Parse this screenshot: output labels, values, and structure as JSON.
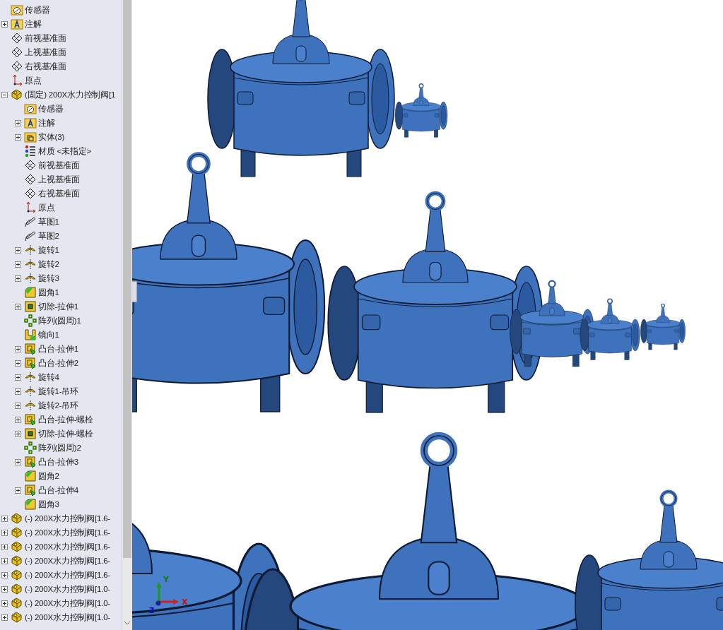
{
  "tree": {
    "items": [
      {
        "label": "传感器",
        "kind": "sensor-folder"
      },
      {
        "label": "注解",
        "kind": "annotation-folder",
        "expanded": false
      },
      {
        "label": "前视基准面",
        "kind": "plane"
      },
      {
        "label": "上视基准面",
        "kind": "plane"
      },
      {
        "label": "右视基准面",
        "kind": "plane"
      },
      {
        "label": "原点",
        "kind": "origin"
      },
      {
        "label": "(固定) 200X水力控制阀[1",
        "kind": "part",
        "expanded": true,
        "children": [
          {
            "label": "传感器",
            "kind": "sensor-folder"
          },
          {
            "label": "注解",
            "kind": "annotation-folder",
            "expanded": false
          },
          {
            "label": "实体(3)",
            "kind": "solid-folder",
            "expanded": false
          },
          {
            "label": "材质 <未指定>",
            "kind": "material"
          },
          {
            "label": "前视基准面",
            "kind": "plane"
          },
          {
            "label": "上视基准面",
            "kind": "plane"
          },
          {
            "label": "右视基准面",
            "kind": "plane"
          },
          {
            "label": "原点",
            "kind": "origin"
          },
          {
            "label": "草图1",
            "kind": "sketch"
          },
          {
            "label": "草图2",
            "kind": "sketch"
          },
          {
            "label": "旋转1",
            "kind": "revolve",
            "expanded": false
          },
          {
            "label": "旋转2",
            "kind": "revolve",
            "expanded": false
          },
          {
            "label": "旋转3",
            "kind": "revolve",
            "expanded": false
          },
          {
            "label": "圆角1",
            "kind": "fillet"
          },
          {
            "label": "切除-拉伸1",
            "kind": "cut",
            "expanded": false
          },
          {
            "label": "阵列(圆周)1",
            "kind": "pattern"
          },
          {
            "label": "镜向1",
            "kind": "mirror"
          },
          {
            "label": "凸台-拉伸1",
            "kind": "boss",
            "expanded": false
          },
          {
            "label": "凸台-拉伸2",
            "kind": "boss",
            "expanded": false
          },
          {
            "label": "旋转4",
            "kind": "revolve",
            "expanded": false
          },
          {
            "label": "旋转1-吊环",
            "kind": "revolve",
            "expanded": false
          },
          {
            "label": "旋转2-吊环",
            "kind": "revolve",
            "expanded": false
          },
          {
            "label": "凸台-拉伸-螺栓",
            "kind": "boss",
            "expanded": false
          },
          {
            "label": "切除-拉伸-螺栓",
            "kind": "cut",
            "expanded": false
          },
          {
            "label": "阵列(圆周)2",
            "kind": "pattern"
          },
          {
            "label": "凸台-拉伸3",
            "kind": "boss",
            "expanded": false
          },
          {
            "label": "圆角2",
            "kind": "fillet"
          },
          {
            "label": "凸台-拉伸4",
            "kind": "boss",
            "expanded": false
          },
          {
            "label": "圆角3",
            "kind": "fillet"
          }
        ]
      },
      {
        "label": "(-) 200X水力控制阀[1.6-",
        "kind": "part",
        "expanded": false
      },
      {
        "label": "(-) 200X水力控制阀[1.6-",
        "kind": "part",
        "expanded": false
      },
      {
        "label": "(-) 200X水力控制阀[1.6-",
        "kind": "part",
        "expanded": false
      },
      {
        "label": "(-) 200X水力控制阀[1.6-",
        "kind": "part",
        "expanded": false
      },
      {
        "label": "(-) 200X水力控制阀[1.6-",
        "kind": "part",
        "expanded": false
      },
      {
        "label": "(-) 200X水力控制阀[1.0-",
        "kind": "part",
        "expanded": false
      },
      {
        "label": "(-) 200X水力控制阀[1.0-",
        "kind": "part",
        "expanded": false
      },
      {
        "label": "(-) 200X水力控制阀[1.0-",
        "kind": "part",
        "expanded": false
      }
    ]
  },
  "viewport": {
    "triad": {
      "x_label": "X",
      "y_label": "Y",
      "z_label": "Z"
    }
  }
}
